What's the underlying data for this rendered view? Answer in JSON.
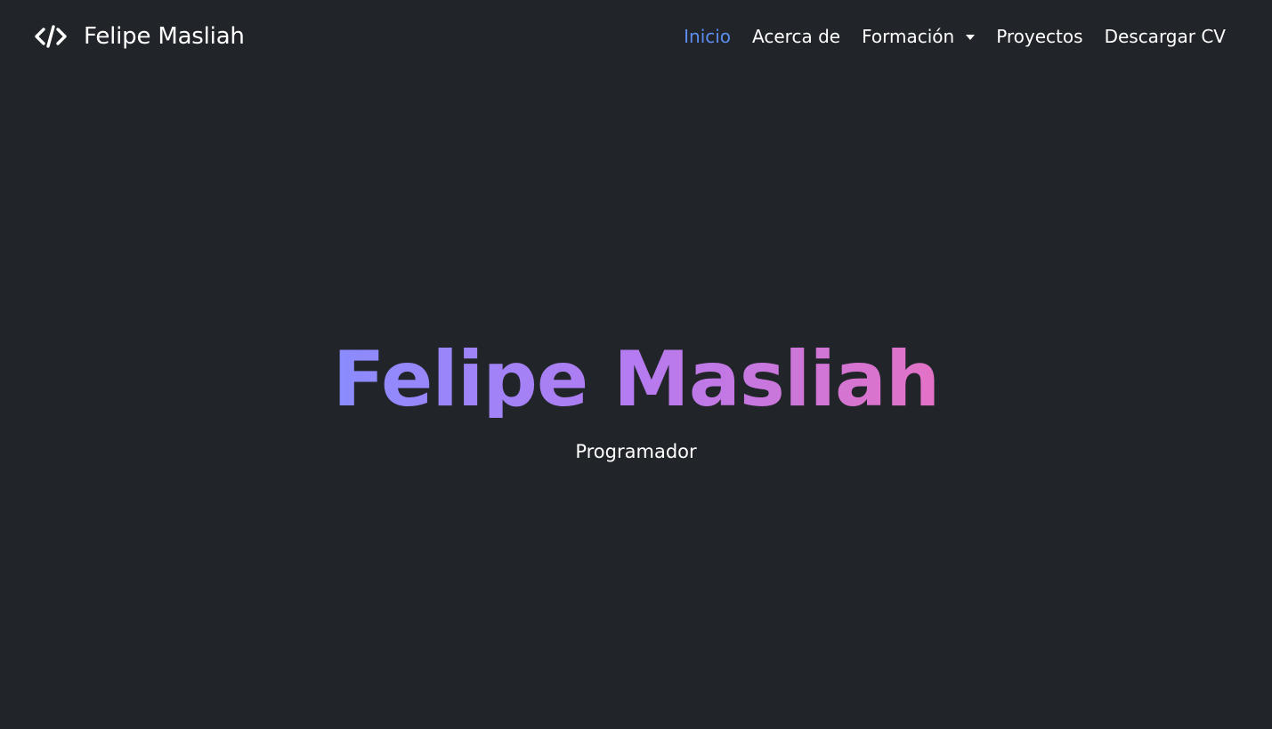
{
  "navbar": {
    "brand_icon": "code-icon",
    "brand_name": "Felipe Masliah",
    "links": [
      {
        "label": "Inicio",
        "active": true
      },
      {
        "label": "Acerca de",
        "active": false
      },
      {
        "label": "Formación",
        "active": false,
        "dropdown": true
      },
      {
        "label": "Proyectos",
        "active": false
      },
      {
        "label": "Descargar CV",
        "active": false
      }
    ]
  },
  "hero": {
    "title": "Felipe Masliah",
    "subtitle": "Programador"
  },
  "colors": {
    "background": "#212529",
    "active_link": "#5b8def",
    "gradient_start": "#8a8cff",
    "gradient_mid": "#b57bf0",
    "gradient_end": "#e372c5"
  }
}
